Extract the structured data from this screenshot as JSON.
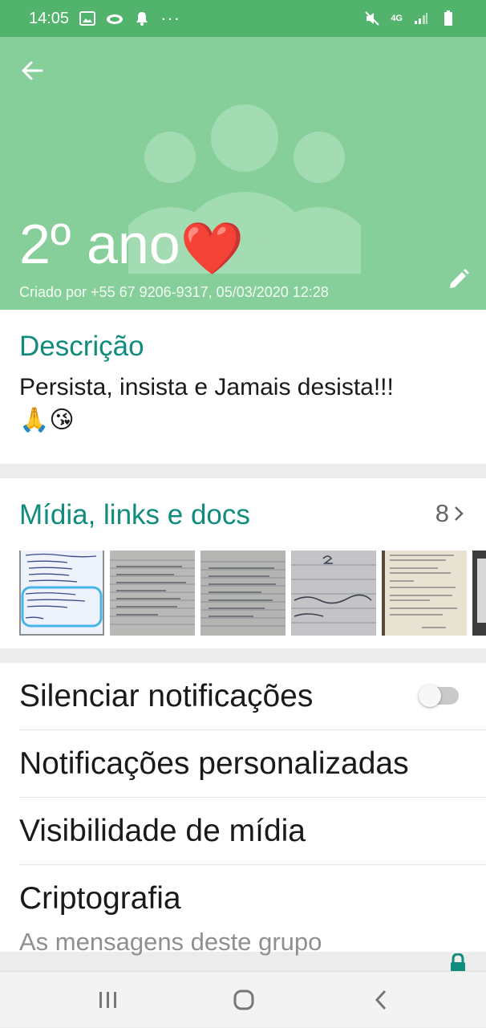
{
  "status_bar": {
    "time": "14:05",
    "dots": "···",
    "network": "4G",
    "icons": [
      "gallery-icon",
      "cloud-icon",
      "bell-icon",
      "mute-icon",
      "signal-icon",
      "battery-icon"
    ]
  },
  "header": {
    "title": "2º ano",
    "emoji": "❤️",
    "created_by": "Criado por +55 67 9206-9317, 05/03/2020 12:28",
    "background_color": "#87cf9a",
    "statusbar_color": "#52b36d"
  },
  "description": {
    "title": "Descrição",
    "text": "Persista, insista e Jamais desista!!!",
    "emojis": "🙏😘"
  },
  "media": {
    "title": "Mídia, links e docs",
    "count": "8",
    "thumbnails": [
      "handwritten-list-photo",
      "lined-notebook-page",
      "lined-notebook-page",
      "notebook-heading-photo",
      "worksheet-photo",
      "partial-photo"
    ]
  },
  "settings": {
    "mute_label": "Silenciar notificações",
    "mute_enabled": false,
    "custom_notif_label": "Notificações personalizadas",
    "media_visibility_label": "Visibilidade de mídia",
    "crypto_label": "Criptografia",
    "crypto_sub": "As mensagens deste grupo"
  },
  "colors": {
    "accent": "#0f8c7c"
  }
}
